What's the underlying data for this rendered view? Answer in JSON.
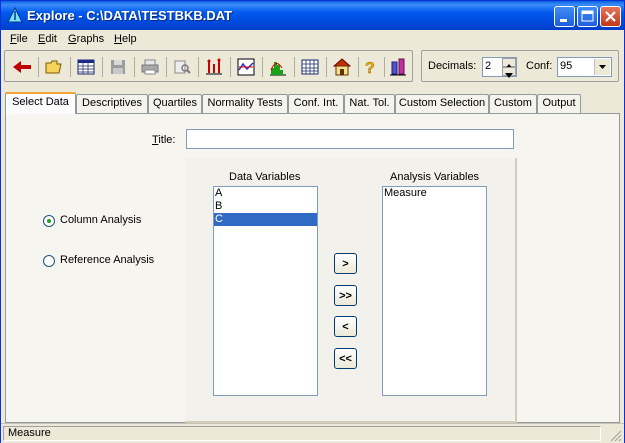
{
  "window": {
    "title": "Explore - C:\\DATA\\TESTBKB.DAT"
  },
  "menu": [
    {
      "label": "File",
      "key": "F",
      "rest": "ile"
    },
    {
      "label": "Edit",
      "key": "E",
      "rest": "dit"
    },
    {
      "label": "Graphs",
      "key": "G",
      "rest": "raphs"
    },
    {
      "label": "Help",
      "key": "H",
      "rest": "elp"
    }
  ],
  "toolbar": {
    "icons": [
      "back-arrow-icon",
      "open-folder-icon",
      "spreadsheet-icon",
      "save-disk-icon",
      "print-icon",
      "print-preview-icon",
      "dot-plot-icon",
      "line-graph-icon",
      "histogram-icon",
      "table-grid-icon",
      "home-icon",
      "help-question-icon",
      "boxplot-icon"
    ]
  },
  "options": {
    "decimals_label": "Decimals:",
    "decimals_value": "2",
    "conf_label": "Conf:",
    "conf_value": "95"
  },
  "tabs": [
    "Select Data",
    "Descriptives",
    "Quartiles",
    "Normality Tests",
    "Conf. Int.",
    "Nat. Tol.",
    "Custom Selection",
    "Custom",
    "Output"
  ],
  "form": {
    "title_label": "Title:",
    "title_value": "",
    "analysis_type": [
      {
        "label": "Column Analysis",
        "checked": true
      },
      {
        "label": "Reference Analysis",
        "checked": false
      }
    ],
    "data_variables_label": "Data Variables",
    "data_variables": [
      "A",
      "B",
      "C"
    ],
    "data_variables_selected": "C",
    "analysis_variables_label": "Analysis Variables",
    "analysis_variables": [
      "Measure"
    ],
    "buttons": [
      ">",
      ">>",
      "<",
      "<<"
    ]
  },
  "status": {
    "text": "Measure"
  },
  "colors": {
    "title_bar": "#0054e3",
    "selection": "#316ac5",
    "active_tab_accent": "#f1a23b"
  }
}
